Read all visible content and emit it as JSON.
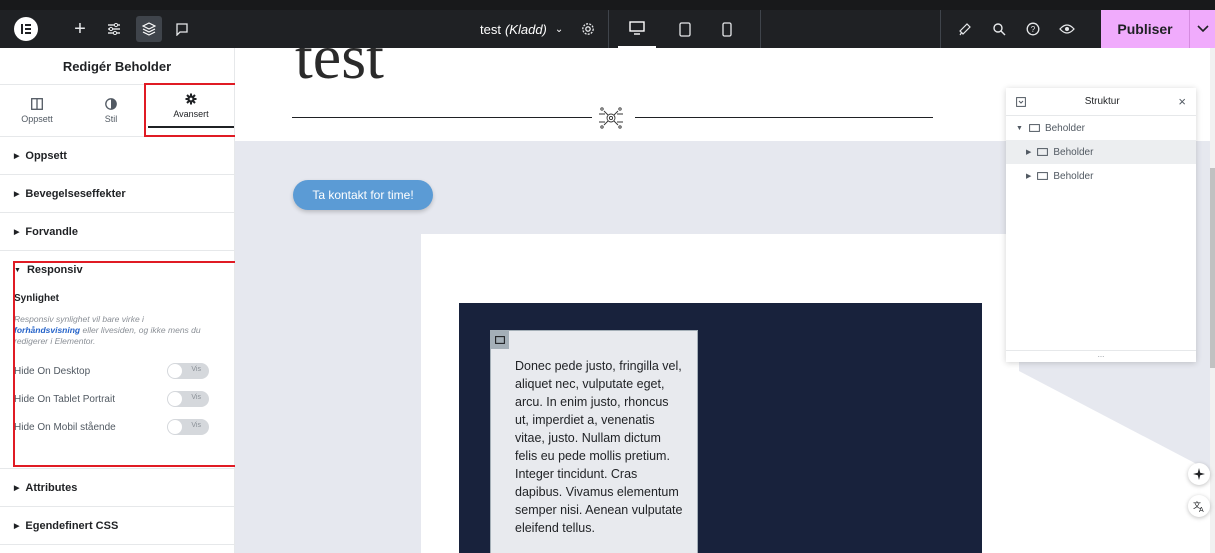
{
  "toolbar": {
    "doc_title": "test",
    "doc_status": "(Kladd)",
    "publish_label": "Publiser"
  },
  "panel": {
    "title": "Redigér Beholder",
    "tabs": [
      {
        "label": "Oppsett"
      },
      {
        "label": "Stil"
      },
      {
        "label": "Avansert"
      }
    ],
    "sections_top": [
      "Oppsett",
      "Bevegelseseffekter",
      "Forvandle"
    ],
    "responsive": {
      "title": "Responsiv",
      "subtitle": "Synlighet",
      "note_pre": "Responsiv synlighet vil bare virke i",
      "note_link": "forhåndsvisning",
      "note_post": "eller livesiden, og ikke mens du redigerer i Elementor.",
      "toggles": [
        {
          "label": "Hide On Desktop",
          "state": "Vis"
        },
        {
          "label": "Hide On Tablet Portrait",
          "state": "Vis"
        },
        {
          "label": "Hide On Mobil stående",
          "state": "Vis"
        }
      ]
    },
    "sections_bottom": [
      "Attributes",
      "Egendefinert CSS"
    ]
  },
  "canvas": {
    "heading": "test",
    "cta_label": "Ta kontakt for time!",
    "body_text": "Donec pede justo, fringilla vel, aliquet nec, vulputate eget, arcu. In enim justo, rhoncus ut, imperdiet a, venenatis vitae, justo. Nullam dictum felis eu pede mollis pretium. Integer tincidunt. Cras dapibus. Vivamus elementum semper nisi. Aenean vulputate eleifend tellus."
  },
  "structure": {
    "title": "Struktur",
    "root": "Beholder",
    "children": [
      "Beholder",
      "Beholder"
    ],
    "footer": "..."
  },
  "colors": {
    "toolbar_bg": "#1f2124",
    "publish_bg": "#f0abfc",
    "highlight_red": "#e01b24",
    "section_dark": "#18223c",
    "cta_blue": "#5b9bd5"
  }
}
